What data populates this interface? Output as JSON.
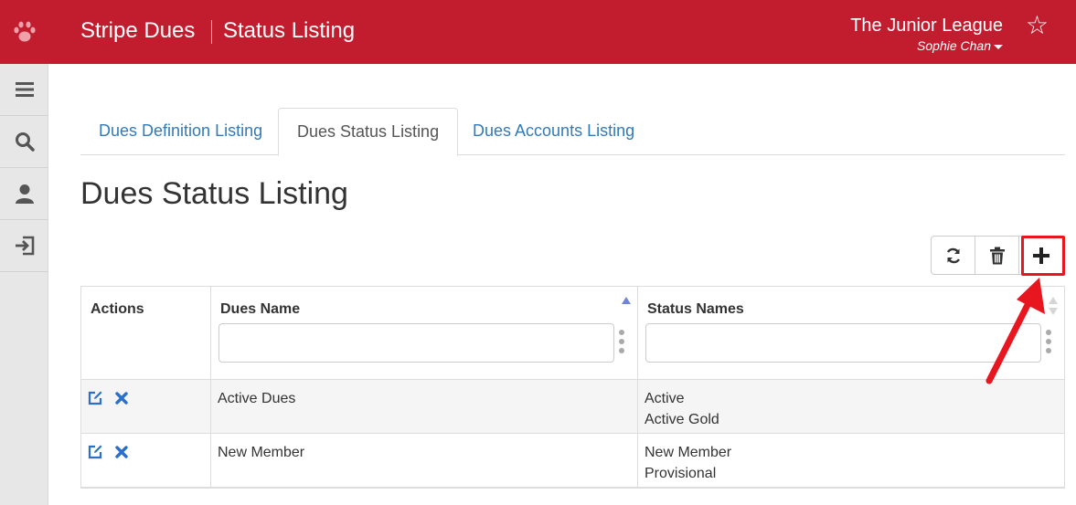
{
  "header": {
    "app_title": "Stripe Dues",
    "page_crumb": "Status Listing",
    "org_name": "The Junior League",
    "user_name": "Sophie Chan",
    "brand_color": "#c21d2f",
    "logo_icon": "paw-icon",
    "favorite_icon": "star-outline-icon"
  },
  "sidebar": {
    "items": [
      {
        "icon": "menu-icon"
      },
      {
        "icon": "search-icon"
      },
      {
        "icon": "user-icon"
      },
      {
        "icon": "logout-icon"
      }
    ]
  },
  "tabs": [
    {
      "label": "Dues Definition Listing",
      "active": false
    },
    {
      "label": "Dues Status Listing",
      "active": true
    },
    {
      "label": "Dues Accounts Listing",
      "active": false
    }
  ],
  "heading": "Dues Status Listing",
  "toolbar": {
    "buttons": [
      {
        "icon": "refresh-icon"
      },
      {
        "icon": "trash-icon"
      },
      {
        "icon": "plus-icon",
        "highlighted": true
      }
    ]
  },
  "table": {
    "columns": [
      {
        "label": "Actions"
      },
      {
        "label": "Dues Name",
        "sort": "ascending"
      },
      {
        "label": "Status Names",
        "sort": "none"
      }
    ],
    "filters": {
      "dues_name": {
        "value": "",
        "placeholder": ""
      },
      "status_names": {
        "value": "",
        "placeholder": ""
      }
    },
    "rows": [
      {
        "dues_name": "Active Dues",
        "status_names": [
          "Active",
          "Active Gold"
        ]
      },
      {
        "dues_name": "New Member",
        "status_names": [
          "New Member",
          "Provisional"
        ]
      }
    ]
  },
  "annotation": {
    "color": "#e8161f"
  }
}
